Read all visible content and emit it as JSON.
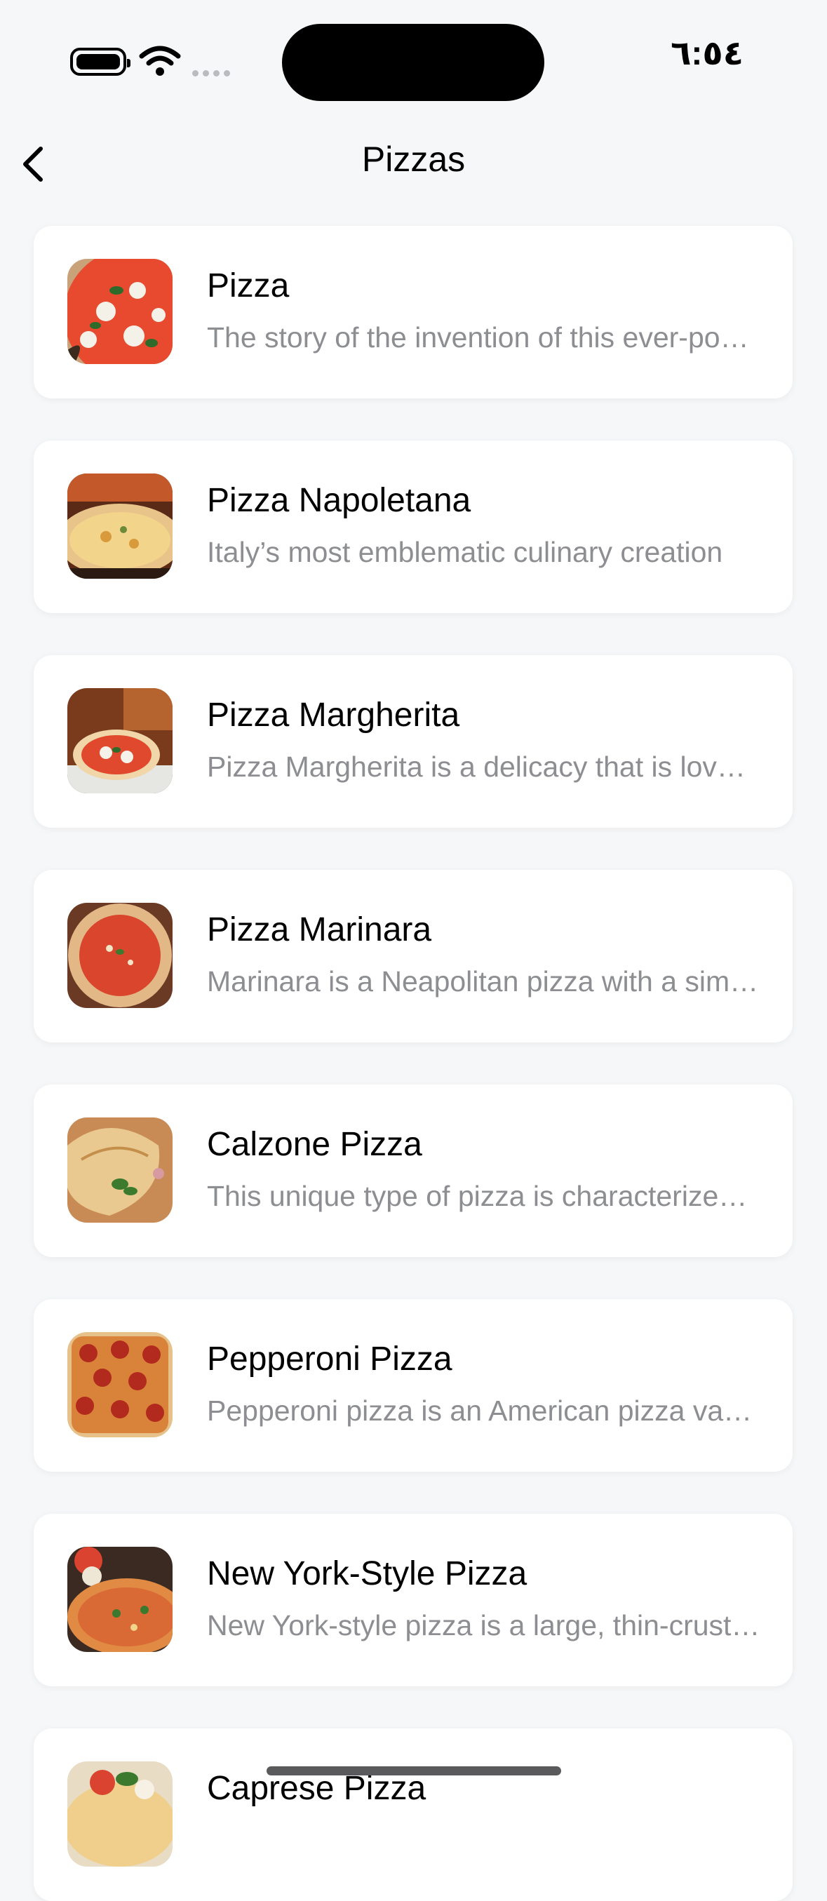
{
  "status_bar": {
    "time": "٦:٥٤",
    "icons": [
      "battery-icon",
      "wifi-icon",
      "signal-icon"
    ]
  },
  "nav": {
    "title": "Pizzas",
    "back_icon": "chevron-left-icon"
  },
  "items": [
    {
      "title": "Pizza",
      "description": "The story of the invention of this ever-popular dish",
      "thumb": "margherita-closeup"
    },
    {
      "title": "Pizza Napoletana",
      "description": "Italy’s most emblematic culinary creation",
      "thumb": "napoletana"
    },
    {
      "title": "Pizza Margherita",
      "description": "Pizza Margherita is a delicacy that is loved worldwide",
      "thumb": "margherita-oven"
    },
    {
      "title": "Pizza Marinara",
      "description": "Marinara is a Neapolitan pizza with a simple topping",
      "thumb": "marinara"
    },
    {
      "title": "Calzone Pizza",
      "description": "This unique type of pizza is characterized by its folded shape",
      "thumb": "calzone"
    },
    {
      "title": "Pepperoni Pizza",
      "description": "Pepperoni pizza is an American pizza variety",
      "thumb": "pepperoni"
    },
    {
      "title": "New York-Style Pizza",
      "description": "New York-style pizza is a large, thin-crust pizza",
      "thumb": "new-york"
    },
    {
      "title": "Caprese Pizza",
      "description": "",
      "thumb": "caprese"
    }
  ],
  "colors": {
    "background": "#f6f7f8",
    "card": "#ffffff",
    "title_text": "#000000",
    "description_text": "#8d8e91"
  }
}
